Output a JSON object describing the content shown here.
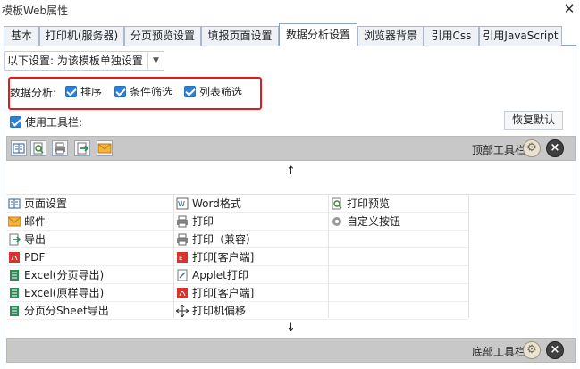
{
  "window": {
    "title": "模板Web属性"
  },
  "tabs": [
    {
      "label": "基本"
    },
    {
      "label": "打印机(服务器)"
    },
    {
      "label": "分页预览设置"
    },
    {
      "label": "填报页面设置"
    },
    {
      "label": "数据分析设置"
    },
    {
      "label": "浏览器背景"
    },
    {
      "label": "引用Css"
    },
    {
      "label": "引用JavaScript"
    }
  ],
  "settings": {
    "combo_value": "以下设置: 为该模板单独设置"
  },
  "analysis": {
    "label": "数据分析:",
    "sort": "排序",
    "filter": "条件筛选",
    "list_filter": "列表筛选"
  },
  "toolbar": {
    "use_label": "使用工具栏:",
    "restore_label": "恢复默认",
    "top_label": "顶部工具栏",
    "bottom_label": "底部工具栏",
    "up_arrow": "↑",
    "down_arrow": "↓"
  },
  "buttons": {
    "col1": [
      "页面设置",
      "邮件",
      "导出",
      "PDF",
      "Excel(分页导出)",
      "Excel(原样导出)",
      "分页分Sheet导出"
    ],
    "col2": [
      "Word格式",
      "打印",
      "打印（兼容）",
      "打印[客户端]",
      "Applet打印",
      "打印[客户端]",
      "打印机偏移"
    ],
    "col3": [
      "打印预览",
      "自定义按钮"
    ]
  },
  "icons": {
    "close": "close-icon",
    "dropdown": "chevron-down-icon",
    "gear": "gear-icon",
    "remove": "remove-circle-icon"
  },
  "colors": {
    "highlight": "#e11b1b",
    "check": "#2f7fd6",
    "bar": "#c8c8c8"
  }
}
